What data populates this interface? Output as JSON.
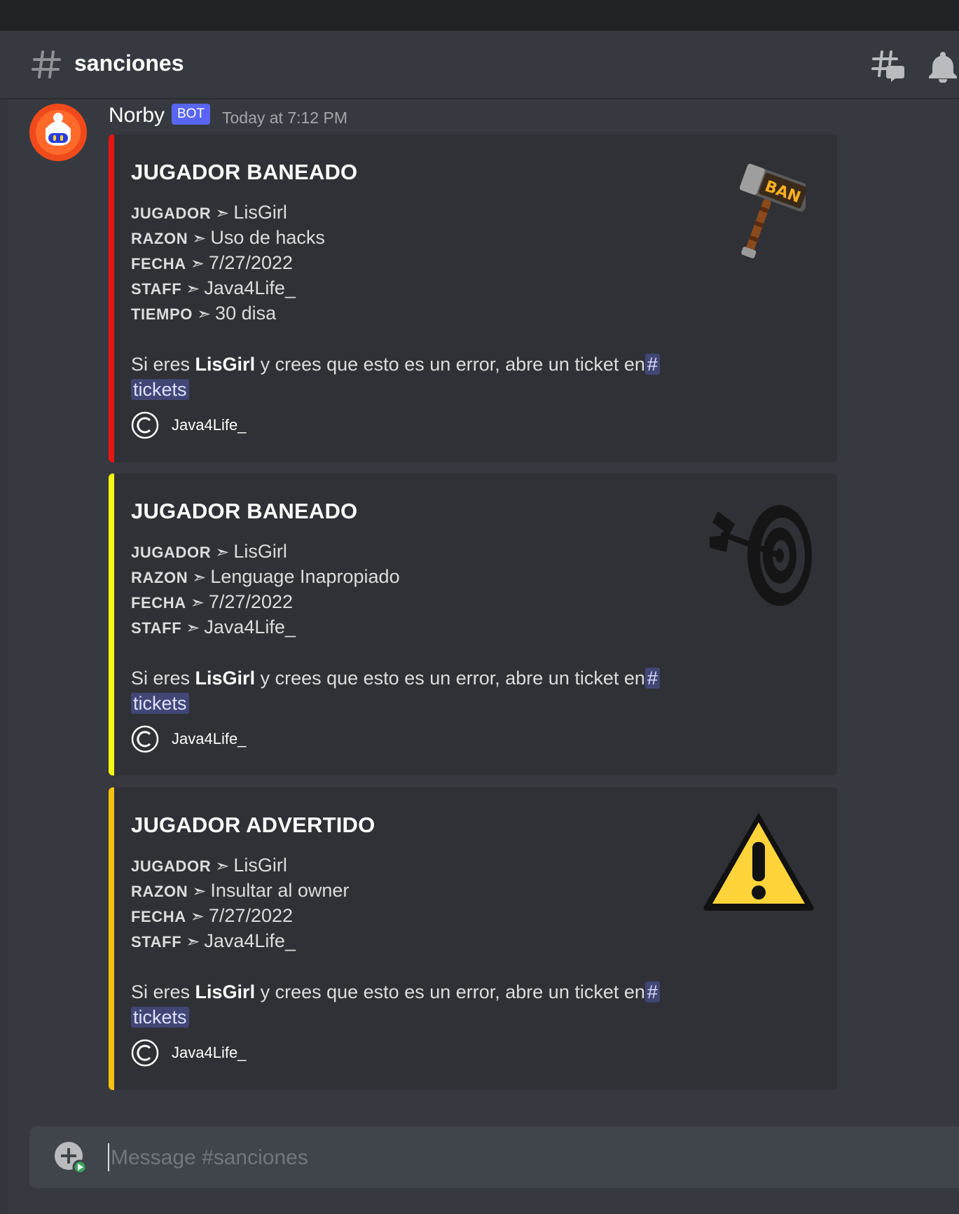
{
  "channel": {
    "name": "sanciones"
  },
  "message": {
    "author": "Norby",
    "bot_tag": "BOT",
    "timestamp": "Today at 7:12 PM"
  },
  "embeds": [
    {
      "color": "#e81414",
      "title": "JUGADOR BANEADO",
      "thumbnail_icon": "ban-hammer-icon",
      "fields": [
        {
          "key": "JUGADOR",
          "value": "LisGirl"
        },
        {
          "key": "RAZON",
          "value": "Uso de hacks"
        },
        {
          "key": "FECHA",
          "value": "7/27/2022"
        },
        {
          "key": "STAFF",
          "value": "Java4Life_"
        },
        {
          "key": "TIEMPO",
          "value": "30 disa"
        }
      ],
      "desc_pre": "Si eres ",
      "desc_bold": "LisGirl",
      "desc_post": " y crees que esto es un error, abre un ticket en",
      "mention_hash": "#",
      "mention_name": "tickets",
      "footer": "Java4Life_"
    },
    {
      "color": "#f7f712",
      "title": "JUGADOR BANEADO",
      "thumbnail_icon": "target-icon",
      "fields": [
        {
          "key": "JUGADOR",
          "value": "LisGirl"
        },
        {
          "key": "RAZON",
          "value": "Lenguage Inapropiado"
        },
        {
          "key": "FECHA",
          "value": "7/27/2022"
        },
        {
          "key": "STAFF",
          "value": "Java4Life_"
        }
      ],
      "desc_pre": "Si eres ",
      "desc_bold": "LisGirl",
      "desc_post": " y crees que esto es un error, abre un ticket en",
      "mention_hash": "#",
      "mention_name": "tickets",
      "footer": "Java4Life_"
    },
    {
      "color": "#f5c211",
      "title": "JUGADOR ADVERTIDO",
      "thumbnail_icon": "warning-icon",
      "fields": [
        {
          "key": "JUGADOR",
          "value": "LisGirl"
        },
        {
          "key": "RAZON",
          "value": "Insultar al owner"
        },
        {
          "key": "FECHA",
          "value": "7/27/2022"
        },
        {
          "key": "STAFF",
          "value": "Java4Life_"
        }
      ],
      "desc_pre": "Si eres ",
      "desc_bold": "LisGirl",
      "desc_post": " y crees que esto es un error, abre un ticket en",
      "mention_hash": "#",
      "mention_name": "tickets",
      "footer": "Java4Life_"
    }
  ],
  "composer": {
    "placeholder": "Message #sanciones"
  }
}
